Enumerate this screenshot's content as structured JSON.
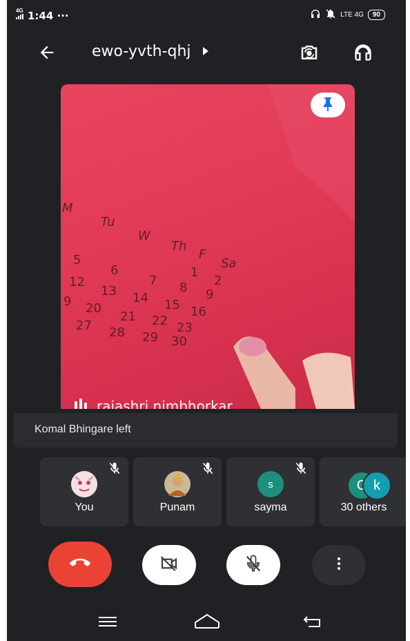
{
  "status_bar": {
    "network": "4G",
    "time": "1:44 ···",
    "right_network": "LTE 4G",
    "battery": "90"
  },
  "header": {
    "meeting_code": "ewo-yvth-qhj",
    "icons": [
      "back-arrow-icon",
      "chevron-right-icon",
      "switch-camera-icon",
      "headphones-icon"
    ]
  },
  "main_video": {
    "participant_name": "rajashri nimbhorkar",
    "pinned_icon": "pin-icon"
  },
  "toast": {
    "message": "Komal Bhingare left"
  },
  "participants": [
    {
      "label": "You",
      "avatar_type": "image",
      "muted": true
    },
    {
      "label": "Punam",
      "avatar_type": "image",
      "muted": true
    },
    {
      "label": "sayma",
      "avatar_letter": "s",
      "avatar_color": "#1e8e7e",
      "muted": true
    },
    {
      "label": "30 others",
      "avatar_letters": [
        "C",
        "k"
      ],
      "avatar_colors": [
        "#1e8e7e",
        "#129eaf"
      ]
    }
  ],
  "controls": {
    "end_call_color": "#ea4335",
    "icons": [
      "end-call-icon",
      "camera-off-icon",
      "mic-off-icon",
      "more-vert-icon"
    ]
  },
  "colors": {
    "background": "#202124",
    "tile": "#2f3033",
    "accent_blue": "#1a73e8"
  }
}
